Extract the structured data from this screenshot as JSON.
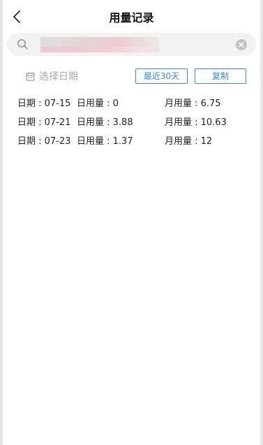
{
  "header": {
    "title": "用量记录",
    "back_icon": "chevron-left-icon"
  },
  "search": {
    "value": "",
    "placeholder": "",
    "icons": [
      "search-icon",
      "clear-icon"
    ]
  },
  "filter": {
    "date_placeholder": "选择日期",
    "calendar_icon": "calendar-icon",
    "recent_button": "最近30天",
    "copy_button": "复制",
    "accent_color": "#3d86d8"
  },
  "records": [
    {
      "date": "日期 : 07-15",
      "daily": "日用量 : 0",
      "monthly": "月用量 : 6.75"
    },
    {
      "date": "日期 : 07-21",
      "daily": "日用量 : 3.88",
      "monthly": "月用量 : 10.63"
    },
    {
      "date": "日期 : 07-23",
      "daily": "日用量 : 1.37",
      "monthly": "月用量 : 12"
    }
  ]
}
